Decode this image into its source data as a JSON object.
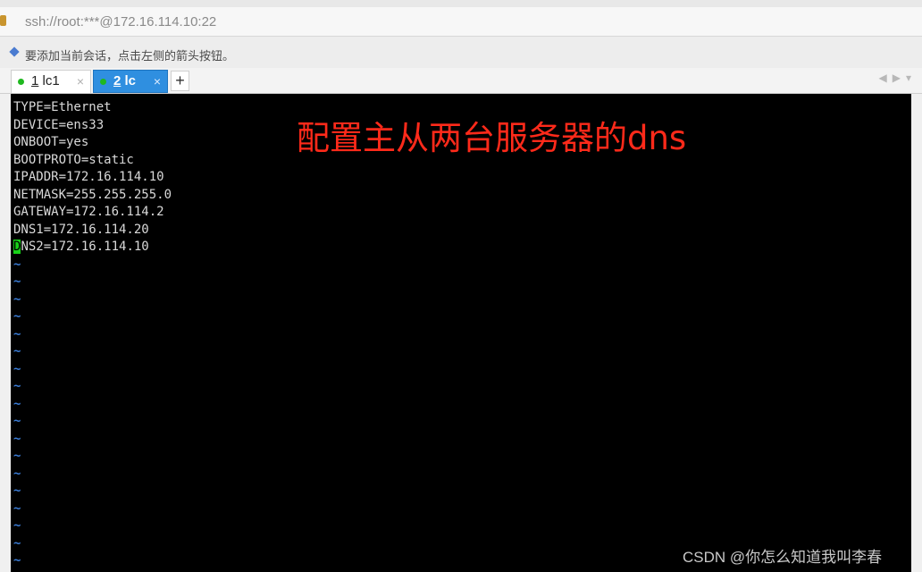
{
  "address": {
    "url": "ssh://root:***@172.16.114.10:22"
  },
  "hint": {
    "text": "要添加当前会话，点击左侧的箭头按钮。"
  },
  "tabs": [
    {
      "number": "1",
      "name": "lc1",
      "close": "×"
    },
    {
      "number": "2",
      "name": "lc",
      "close": "×"
    }
  ],
  "add_tab": "+",
  "scroll": {
    "left": "◀",
    "right": "▶",
    "menu": "▾"
  },
  "terminal": {
    "lines": [
      "TYPE=Ethernet",
      "DEVICE=ens33",
      "ONBOOT=yes",
      "BOOTPROTO=static",
      "IPADDR=172.16.114.10",
      "NETMASK=255.255.255.0",
      "GATEWAY=172.16.114.2",
      "DNS1=172.16.114.20"
    ],
    "cursor_char": "D",
    "cursor_line_rest": "NS2=172.16.114.10",
    "tilde": "~",
    "empty_line_count": 18
  },
  "overlay_text": "配置主从两台服务器的dns",
  "watermark": "CSDN @你怎么知道我叫李春",
  "colors": {
    "terminal_bg": "#000000",
    "text": "#d9d9d9",
    "cursor": "#18d118",
    "tilde": "#3a7bd5",
    "overlay": "#ff2a1a",
    "active_tab": "#2f8fe0"
  }
}
